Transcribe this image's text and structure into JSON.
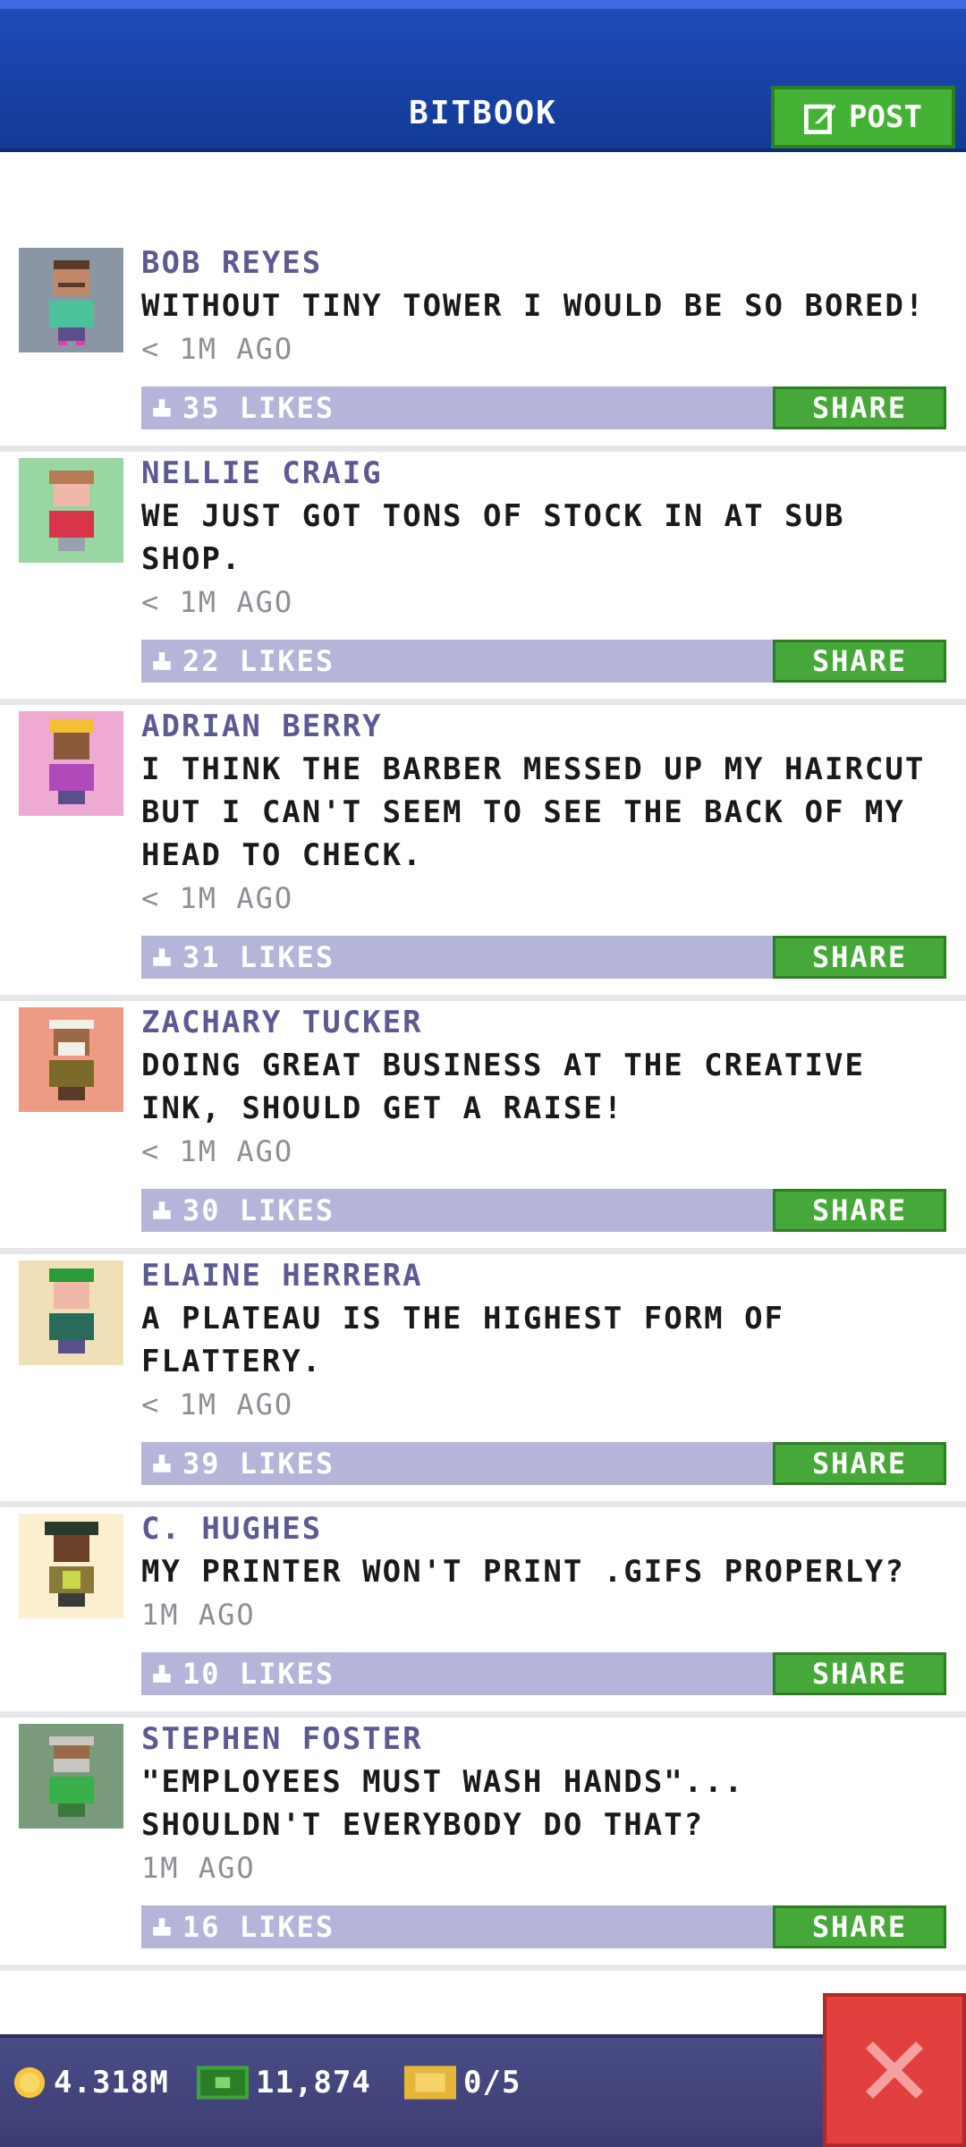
{
  "header": {
    "title": "BITBOOK",
    "post_label": "POST",
    "colors": {
      "bar": "#1f4bb8",
      "post_button": "#44b335"
    }
  },
  "posts": [
    {
      "name": "BOB REYES",
      "lines": [
        "WITHOUT TINY TOWER I WOULD BE SO BORED!"
      ],
      "time": "< 1M AGO",
      "likes": "35 LIKES",
      "share": "SHARE",
      "avatar_bg": "#8a96a3"
    },
    {
      "name": "NELLIE CRAIG",
      "lines": [
        "WE JUST GOT TONS OF STOCK IN AT SUB",
        "SHOP."
      ],
      "time": "< 1M AGO",
      "likes": "22 LIKES",
      "share": "SHARE",
      "avatar_bg": "#98d6a4"
    },
    {
      "name": "ADRIAN BERRY",
      "lines": [
        "I THINK THE BARBER MESSED UP MY HAIRCUT",
        "BUT I CAN'T SEEM TO SEE THE BACK OF MY",
        "HEAD TO CHECK."
      ],
      "time": "< 1M AGO",
      "likes": "31 LIKES",
      "share": "SHARE",
      "avatar_bg": "#eeaad2"
    },
    {
      "name": "ZACHARY TUCKER",
      "lines": [
        "DOING GREAT BUSINESS AT THE CREATIVE",
        "INK, SHOULD GET A RAISE!"
      ],
      "time": "< 1M AGO",
      "likes": "30 LIKES",
      "share": "SHARE",
      "avatar_bg": "#ee9b86"
    },
    {
      "name": "ELAINE HERRERA",
      "lines": [
        "A PLATEAU IS THE HIGHEST FORM OF",
        "FLATTERY."
      ],
      "time": "< 1M AGO",
      "likes": "39 LIKES",
      "share": "SHARE",
      "avatar_bg": "#f1dfb8"
    },
    {
      "name": "C. HUGHES",
      "lines": [
        "MY PRINTER WON'T PRINT .GIFS PROPERLY?"
      ],
      "time": "1M AGO",
      "likes": "10 LIKES",
      "share": "SHARE",
      "avatar_bg": "#fcefd0"
    },
    {
      "name": "STEPHEN FOSTER",
      "lines": [
        "\"EMPLOYEES MUST WASH HANDS\"...",
        "SHOULDN'T EVERYBODY DO THAT?"
      ],
      "time": "1M AGO",
      "likes": "16 LIKES",
      "share": "SHARE",
      "avatar_bg": "#7a9a7c"
    }
  ],
  "footer": {
    "coins": "4.318M",
    "bux": "11,874",
    "tickets": "0/5",
    "colors": {
      "coin": "#f6c53b",
      "bux": "#3fa33a",
      "ticket": "#e7b53a",
      "close": "#e23f3f"
    }
  }
}
